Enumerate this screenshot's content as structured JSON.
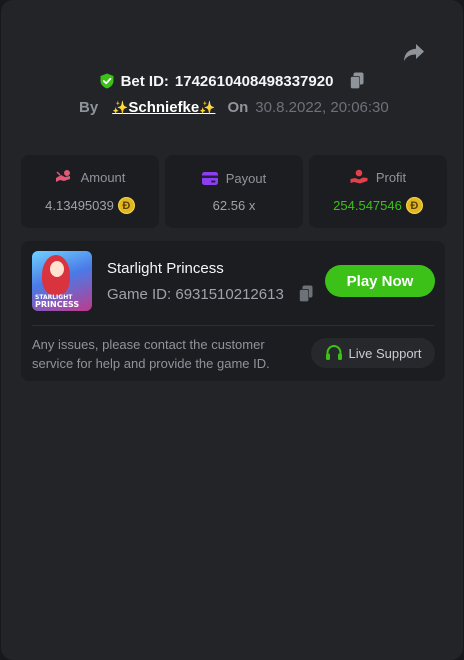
{
  "header": {
    "bet_label": "Bet ID:",
    "bet_id": "1742610408498337920",
    "by_label": "By",
    "username": "Schniefke",
    "spark_left": "✨",
    "spark_right": "✨",
    "on_label": "On",
    "date": "30.8.2022, 20:06:30"
  },
  "stats": [
    {
      "label": "Amount",
      "value": "4.13495039",
      "icon": "amount-icon",
      "currency": "Ð"
    },
    {
      "label": "Payout",
      "value": "62.56 x",
      "icon": "payout-card-icon"
    },
    {
      "label": "Profit",
      "value": "254.547546",
      "icon": "profit-hand-icon",
      "currency": "Ð"
    }
  ],
  "game": {
    "name": "Starlight Princess",
    "id_text": "Game ID: 6931510212613",
    "thumb_line1": "STARLIGHT",
    "thumb_line2": "PRINCESS",
    "play_label": "Play Now"
  },
  "support": {
    "notice": "Any issues, please contact the customer service for help and provide the game ID.",
    "button_label": "Live Support"
  },
  "colors": {
    "background": "#232428",
    "card": "#1c1d20",
    "accent_green": "#3bc117",
    "coin": "#e1b823",
    "muted_text": "#8f949b"
  }
}
